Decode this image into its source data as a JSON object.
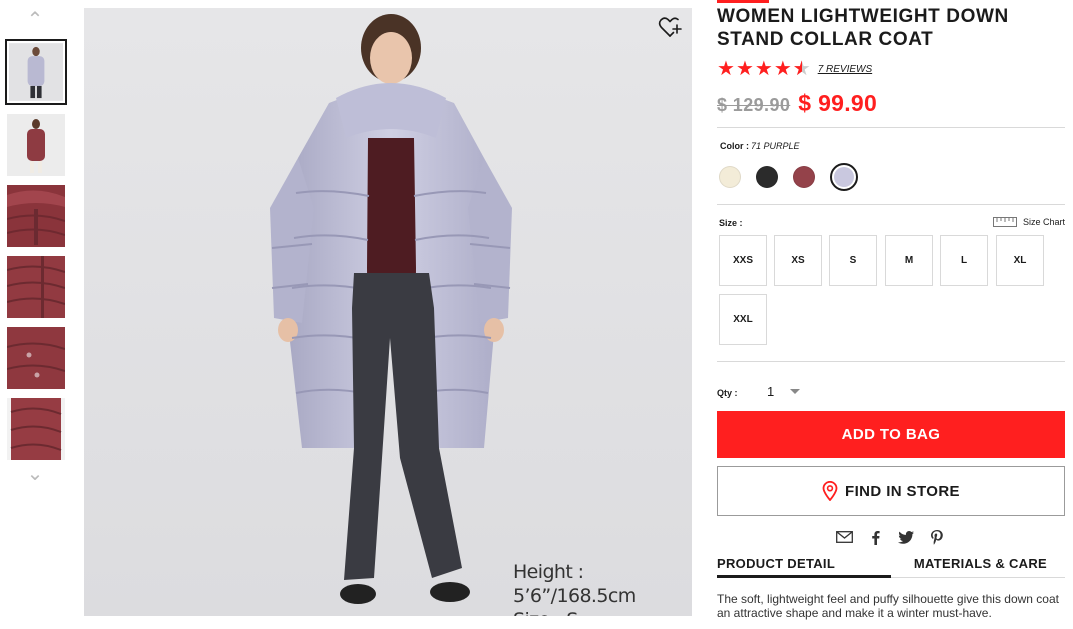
{
  "thumbnails": {
    "up_icon": "chevron-up",
    "down_icon": "chevron-down",
    "items": [
      {
        "label": "thumbnail-1",
        "kind": "model-lavender"
      },
      {
        "label": "thumbnail-2",
        "kind": "model-red"
      },
      {
        "label": "thumbnail-3",
        "kind": "collar-detail"
      },
      {
        "label": "thumbnail-4",
        "kind": "quilt-detail"
      },
      {
        "label": "thumbnail-5",
        "kind": "button-detail"
      },
      {
        "label": "thumbnail-6",
        "kind": "sleeve-detail"
      }
    ]
  },
  "main_image": {
    "wishlist_icon": "heart-plus",
    "caption_height": "Height : 5’6”/168.5cm",
    "caption_size": "Size : S"
  },
  "product": {
    "title": "WOMEN LIGHTWEIGHT DOWN STAND COLLAR COAT",
    "rating": 4.5,
    "reviews": "7 REVIEWS",
    "old_price": "$ 129.90",
    "new_price": "$ 99.90",
    "accent_color": "#ff1f1f"
  },
  "color": {
    "label": "Color :",
    "selected": "71 PURPLE",
    "swatches": [
      "#f3ecd8",
      "#2b2b2b",
      "#94424a",
      "#c9c8df"
    ]
  },
  "size": {
    "label": "Size :",
    "chart_label": "Size Chart",
    "options": [
      "XXS",
      "XS",
      "S",
      "M",
      "L",
      "XL",
      "XXL"
    ]
  },
  "qty": {
    "label": "Qty :",
    "value": "1"
  },
  "actions": {
    "add_to_bag": "ADD TO BAG",
    "find_in_store": "FIND IN STORE"
  },
  "share": [
    "email-icon",
    "facebook-icon",
    "twitter-icon",
    "pinterest-icon"
  ],
  "tabs": {
    "detail": "PRODUCT DETAIL",
    "materials": "MATERIALS & CARE"
  },
  "description": "The soft, lightweight feel and puffy silhouette give this down coat an attractive shape and make it a winter must-have."
}
